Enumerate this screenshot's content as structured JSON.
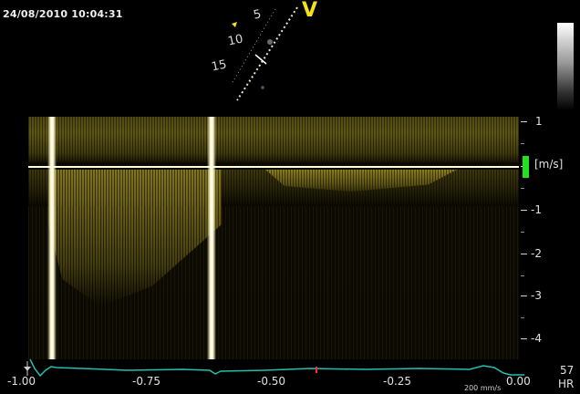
{
  "header": {
    "timestamp": "24/08/2010 10:04:31"
  },
  "sector_view": {
    "depth_labels": [
      "5",
      "10",
      "15"
    ],
    "mode_label": "V"
  },
  "velocity_scale": {
    "unit": "[m/s]",
    "ticks": [
      "1",
      "-1",
      "-2",
      "-3",
      "-4"
    ]
  },
  "time_axis": {
    "ticks": [
      "-1.00",
      "-0.75",
      "-0.50",
      "-0.25",
      "0.00"
    ],
    "sweep_speed": "200 mm/s"
  },
  "heart_rate": {
    "value": "57",
    "label": "HR"
  },
  "colors": {
    "spectrum": "#7a6e1c",
    "baseline": "#ffffe0",
    "ecg_trace": "#22c0b0",
    "zero_marker": "#22e022",
    "mode_label": "#f3e21a"
  }
}
